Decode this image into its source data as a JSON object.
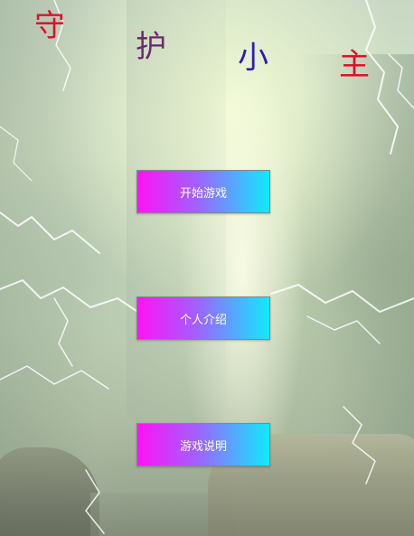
{
  "title": {
    "chars": [
      "守",
      "护",
      "小",
      "主"
    ],
    "colors": [
      "#e0102a",
      "#6b2a6f",
      "#2a18c8",
      "#e0102a"
    ]
  },
  "menu": {
    "start_label": "开始游戏",
    "about_label": "个人介绍",
    "help_label": "游戏说明"
  },
  "theme": {
    "button_gradient_start": "#ff12f4",
    "button_gradient_end": "#10eaff"
  }
}
